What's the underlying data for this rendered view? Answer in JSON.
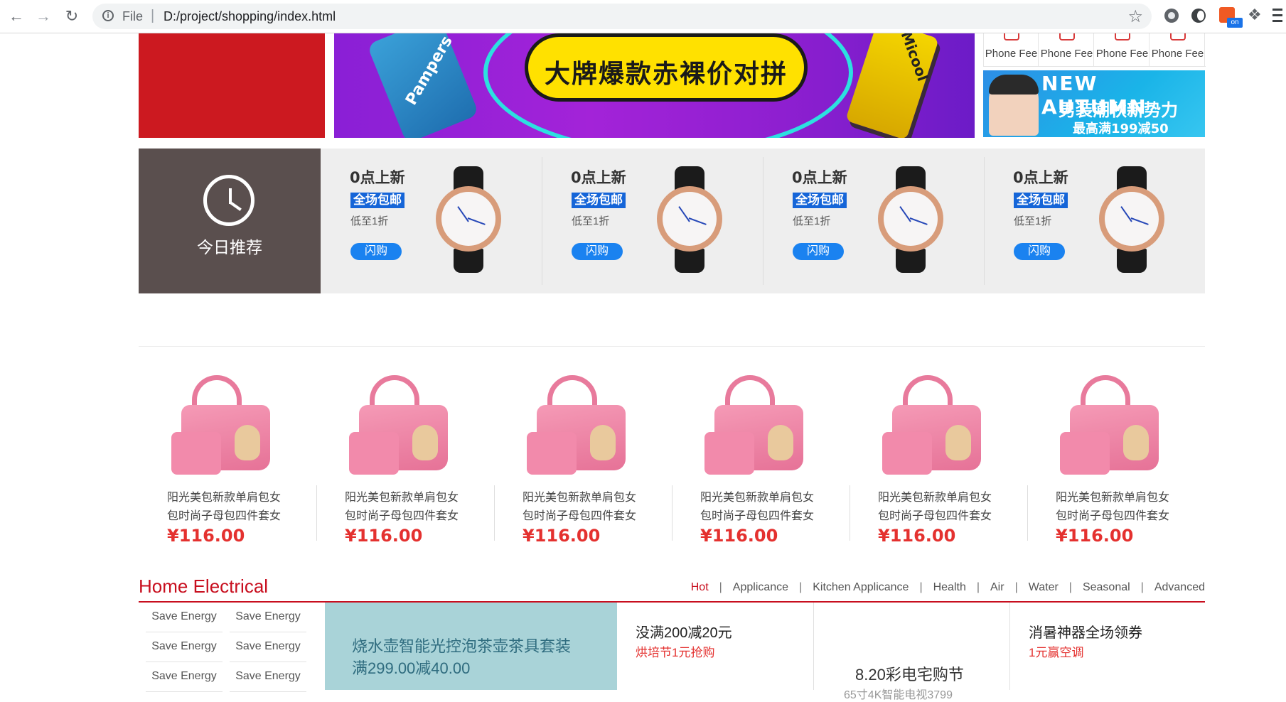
{
  "browser": {
    "scheme": "File",
    "separator": "|",
    "url": "D:/project/shopping/index.html",
    "ext_badge": "on"
  },
  "banner": {
    "headline": "大牌爆款赤裸价对拼",
    "product_label_left": "Pampers",
    "product_label_right": "Micool"
  },
  "phone_fee": {
    "items": [
      "Phone Fee",
      "Phone Fee",
      "Phone Fee",
      "Phone Fee"
    ]
  },
  "autumn_ad": {
    "title": "NEW AUTUMN",
    "subtitle": "男装潮秋新势力",
    "offer": "最高满199减50"
  },
  "recommend": {
    "title": "今日推荐",
    "cards": [
      {
        "new": "0点上新",
        "badge": "全场包邮",
        "discount": "低至1折",
        "button": "闪购"
      },
      {
        "new": "0点上新",
        "badge": "全场包邮",
        "discount": "低至1折",
        "button": "闪购"
      },
      {
        "new": "0点上新",
        "badge": "全场包邮",
        "discount": "低至1折",
        "button": "闪购"
      },
      {
        "new": "0点上新",
        "badge": "全场包邮",
        "discount": "低至1折",
        "button": "闪购"
      }
    ]
  },
  "products": [
    {
      "name1": "阳光美包新款单肩包女",
      "name2": "包时尚子母包四件套女",
      "price": "¥116.00"
    },
    {
      "name1": "阳光美包新款单肩包女",
      "name2": "包时尚子母包四件套女",
      "price": "¥116.00"
    },
    {
      "name1": "阳光美包新款单肩包女",
      "name2": "包时尚子母包四件套女",
      "price": "¥116.00"
    },
    {
      "name1": "阳光美包新款单肩包女",
      "name2": "包时尚子母包四件套女",
      "price": "¥116.00"
    },
    {
      "name1": "阳光美包新款单肩包女",
      "name2": "包时尚子母包四件套女",
      "price": "¥116.00"
    },
    {
      "name1": "阳光美包新款单肩包女",
      "name2": "包时尚子母包四件套女",
      "price": "¥116.00"
    }
  ],
  "home_electrical": {
    "title": "Home Electrical",
    "tabs": [
      "Hot",
      "Applicance",
      "Kitchen Applicance",
      "Health",
      "Air",
      "Water",
      "Seasonal",
      "Advanced"
    ],
    "save_energy": [
      "Save Energy",
      "Save Energy",
      "Save Energy",
      "Save Energy",
      "Save Energy",
      "Save Energy"
    ],
    "kettle": {
      "line1": "烧水壶智能光控泡茶壶茶具套装",
      "line2": "满299.00减40.00"
    },
    "promo1": {
      "title": "没满200减20元",
      "sub": "烘培节1元抢购"
    },
    "promo2": {
      "title": "8.20彩电宅购节",
      "sub": "65寸4K智能电视3799"
    },
    "promo3": {
      "title": "消暑神器全场领券",
      "sub": "1元赢空调"
    }
  },
  "colors": {
    "brand_red": "#c80e1e",
    "price_red": "#e4312f",
    "flash_blue": "#1a82f0",
    "recommend_bg": "#5a4f4e"
  }
}
